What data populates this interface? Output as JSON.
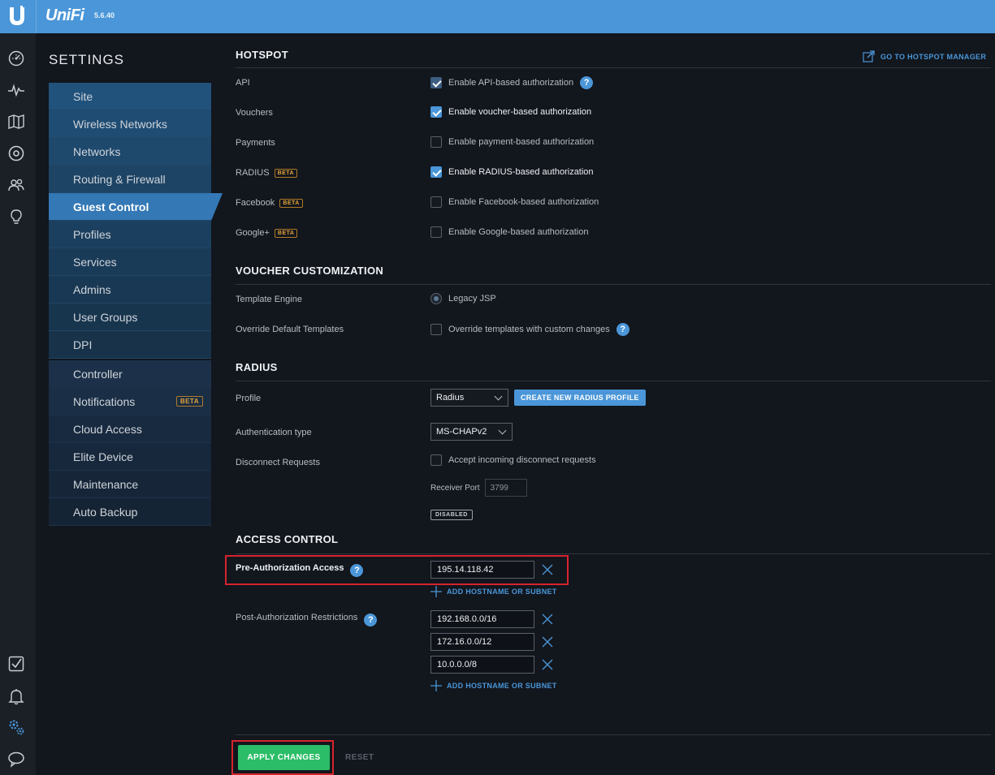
{
  "app": {
    "logo_text": "UniFi",
    "version": "5.6.40"
  },
  "settings_title": "SETTINGS",
  "nav": {
    "group_a": [
      {
        "label": "Site"
      },
      {
        "label": "Wireless Networks"
      },
      {
        "label": "Networks"
      },
      {
        "label": "Routing & Firewall"
      },
      {
        "label": "Guest Control",
        "active": true
      },
      {
        "label": "Profiles"
      },
      {
        "label": "Services"
      },
      {
        "label": "Admins"
      },
      {
        "label": "User Groups"
      },
      {
        "label": "DPI"
      }
    ],
    "group_b": [
      {
        "label": "Controller"
      },
      {
        "label": "Notifications",
        "badge": "BETA"
      },
      {
        "label": "Cloud Access"
      },
      {
        "label": "Elite Device"
      },
      {
        "label": "Maintenance"
      },
      {
        "label": "Auto Backup"
      }
    ]
  },
  "rail_icons": [
    "dashboard-icon",
    "statistics-icon",
    "map-icon",
    "devices-icon",
    "clients-icon",
    "insights-icon",
    "events-icon",
    "alerts-icon",
    "settings-icon",
    "chat-icon"
  ],
  "hotspot": {
    "title": "HOTSPOT",
    "manager_link": "GO TO HOTSPOT MANAGER",
    "rows": {
      "api": {
        "label": "API",
        "control": "Enable API-based authorization",
        "checked": true
      },
      "vouchers": {
        "label": "Vouchers",
        "control": "Enable voucher-based authorization",
        "checked": true
      },
      "payments": {
        "label": "Payments",
        "control": "Enable payment-based authorization",
        "checked": false
      },
      "radius": {
        "label": "RADIUS",
        "badge": "BETA",
        "control": "Enable RADIUS-based authorization",
        "checked": true
      },
      "facebook": {
        "label": "Facebook",
        "badge": "BETA",
        "control": "Enable Facebook-based authorization",
        "checked": false
      },
      "google": {
        "label": "Google+",
        "badge": "BETA",
        "control": "Enable Google-based authorization",
        "checked": false
      }
    }
  },
  "voucher": {
    "title": "VOUCHER CUSTOMIZATION",
    "template_engine_label": "Template Engine",
    "template_engine_value": "Legacy JSP",
    "override_label": "Override Default Templates",
    "override_control": "Override templates with custom changes"
  },
  "radius": {
    "title": "RADIUS",
    "profile_label": "Profile",
    "profile_value": "Radius",
    "create_button": "CREATE NEW RADIUS PROFILE",
    "auth_label": "Authentication type",
    "auth_value": "MS-CHAPv2",
    "disconnect_label": "Disconnect Requests",
    "disconnect_control": "Accept incoming disconnect requests",
    "receiver_port_label": "Receiver Port",
    "receiver_port_value": "3799",
    "status": "DISABLED"
  },
  "access": {
    "title": "ACCESS CONTROL",
    "pre_label": "Pre-Authorization Access",
    "pre_entries": [
      "195.14.118.42"
    ],
    "post_label": "Post-Authorization Restrictions",
    "post_entries": [
      "192.168.0.0/16",
      "172.16.0.0/12",
      "10.0.0.0/8"
    ],
    "add_link": "ADD HOSTNAME OR SUBNET"
  },
  "footer": {
    "apply": "APPLY CHANGES",
    "reset": "RESET"
  },
  "colors": {
    "accent": "#4a96d8",
    "apply": "#2bbd67",
    "highlight": "#d6242d",
    "beta": "#e2a23a"
  }
}
